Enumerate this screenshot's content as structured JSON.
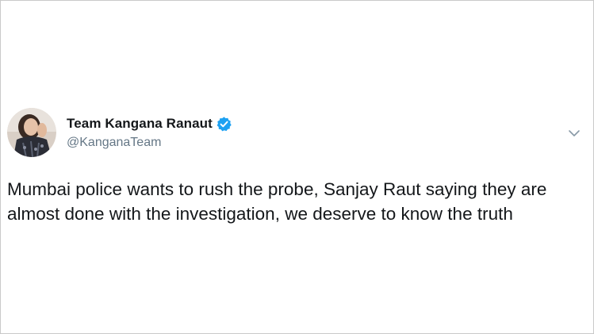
{
  "tweet": {
    "author": {
      "display_name": "Team Kangana Ranaut",
      "handle": "@KanganaTeam",
      "verified_icon": "verified-badge-icon"
    },
    "text_lines": [
      "Mumbai police wants to rush the probe, Sanjay Raut saying they are",
      "almost done with the investigation, we deserve to know the truth"
    ],
    "menu_icon": "chevron-down-icon"
  },
  "colors": {
    "name": "#14171a",
    "handle": "#657786",
    "verified": "#1da1f2",
    "border": "#c9c9c9",
    "caret": "#8899a6"
  }
}
